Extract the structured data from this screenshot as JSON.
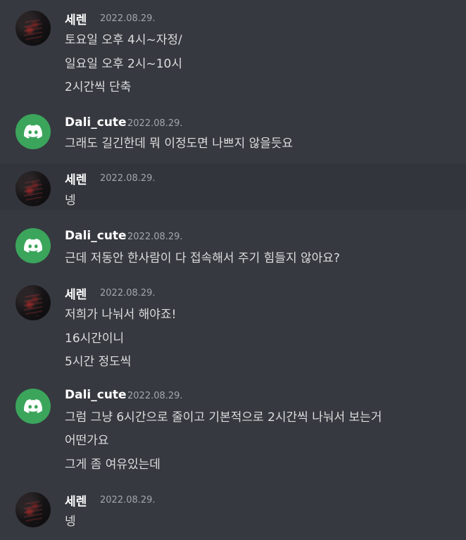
{
  "messages": [
    {
      "author": "세렌",
      "timestamp": "2022.08.29.",
      "avatar": "photo-avatar",
      "lines": [
        "토요일 오후 4시~자정/",
        "일요일 오후 2시~10시",
        "2시간씩 단축"
      ]
    },
    {
      "author": "Dali_cute",
      "timestamp": "2022.08.29.",
      "avatar": "discord-logo-avatar",
      "lines": [
        "그래도 길긴한데 뭐 이정도면 나쁘지 않을듯요"
      ]
    },
    {
      "author": "세렌",
      "timestamp": "2022.08.29.",
      "avatar": "photo-avatar",
      "lines": [
        "넹"
      ]
    },
    {
      "author": "Dali_cute",
      "timestamp": "2022.08.29.",
      "avatar": "discord-logo-avatar",
      "lines": [
        "근데 저동안 한사람이 다 접속해서 주기 힘들지 않아요?"
      ]
    },
    {
      "author": "세렌",
      "timestamp": "2022.08.29.",
      "avatar": "photo-avatar",
      "lines": [
        "저희가 나눠서 해야죠!",
        "16시간이니",
        "5시간 정도씩"
      ]
    },
    {
      "author": "Dali_cute",
      "timestamp": "2022.08.29.",
      "avatar": "discord-logo-avatar",
      "lines": [
        "그럼 그냥 6시간으로 줄이고 기본적으로 2시간씩 나눠서 보는거",
        "어떤가요",
        "그게 좀 여유있는데"
      ]
    },
    {
      "author": "세렌",
      "timestamp": "2022.08.29.",
      "avatar": "photo-avatar",
      "lines": [
        "넹"
      ]
    }
  ],
  "colors": {
    "background": "#36393f",
    "hover_background": "#32353b",
    "discord_green": "#3ba55c",
    "username": "#ffffff",
    "timestamp": "#a3a6aa",
    "message_text": "#dcddde"
  }
}
